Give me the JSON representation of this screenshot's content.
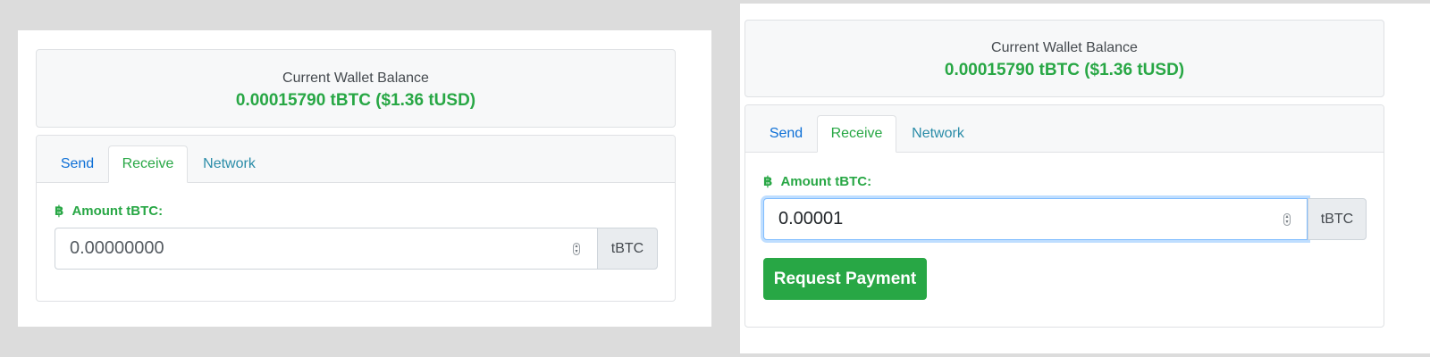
{
  "colors": {
    "accent_green": "#28a745",
    "link_blue": "#0d6fd6",
    "network_teal": "#2a8ca8",
    "border": "#dfe1e4",
    "background": "#dcdcdc"
  },
  "panels": [
    {
      "balance": {
        "label": "Current Wallet Balance",
        "value": "0.00015790 tBTC ($1.36 tUSD)"
      },
      "tabs": [
        {
          "label": "Send",
          "active": false
        },
        {
          "label": "Receive",
          "active": true
        },
        {
          "label": "Network",
          "active": false
        }
      ],
      "receive": {
        "icon": "bitcoin-icon",
        "amount_label": "Amount tBTC:",
        "amount_value": "0.00000000",
        "unit_addon": "tBTC"
      }
    },
    {
      "balance": {
        "label": "Current Wallet Balance",
        "value": "0.00015790 tBTC ($1.36 tUSD)"
      },
      "tabs": [
        {
          "label": "Send",
          "active": false
        },
        {
          "label": "Receive",
          "active": true
        },
        {
          "label": "Network",
          "active": false
        }
      ],
      "receive": {
        "icon": "bitcoin-icon",
        "amount_label": "Amount tBTC:",
        "amount_value": "0.00001",
        "unit_addon": "tBTC",
        "submit_label": "Request Payment"
      }
    }
  ]
}
